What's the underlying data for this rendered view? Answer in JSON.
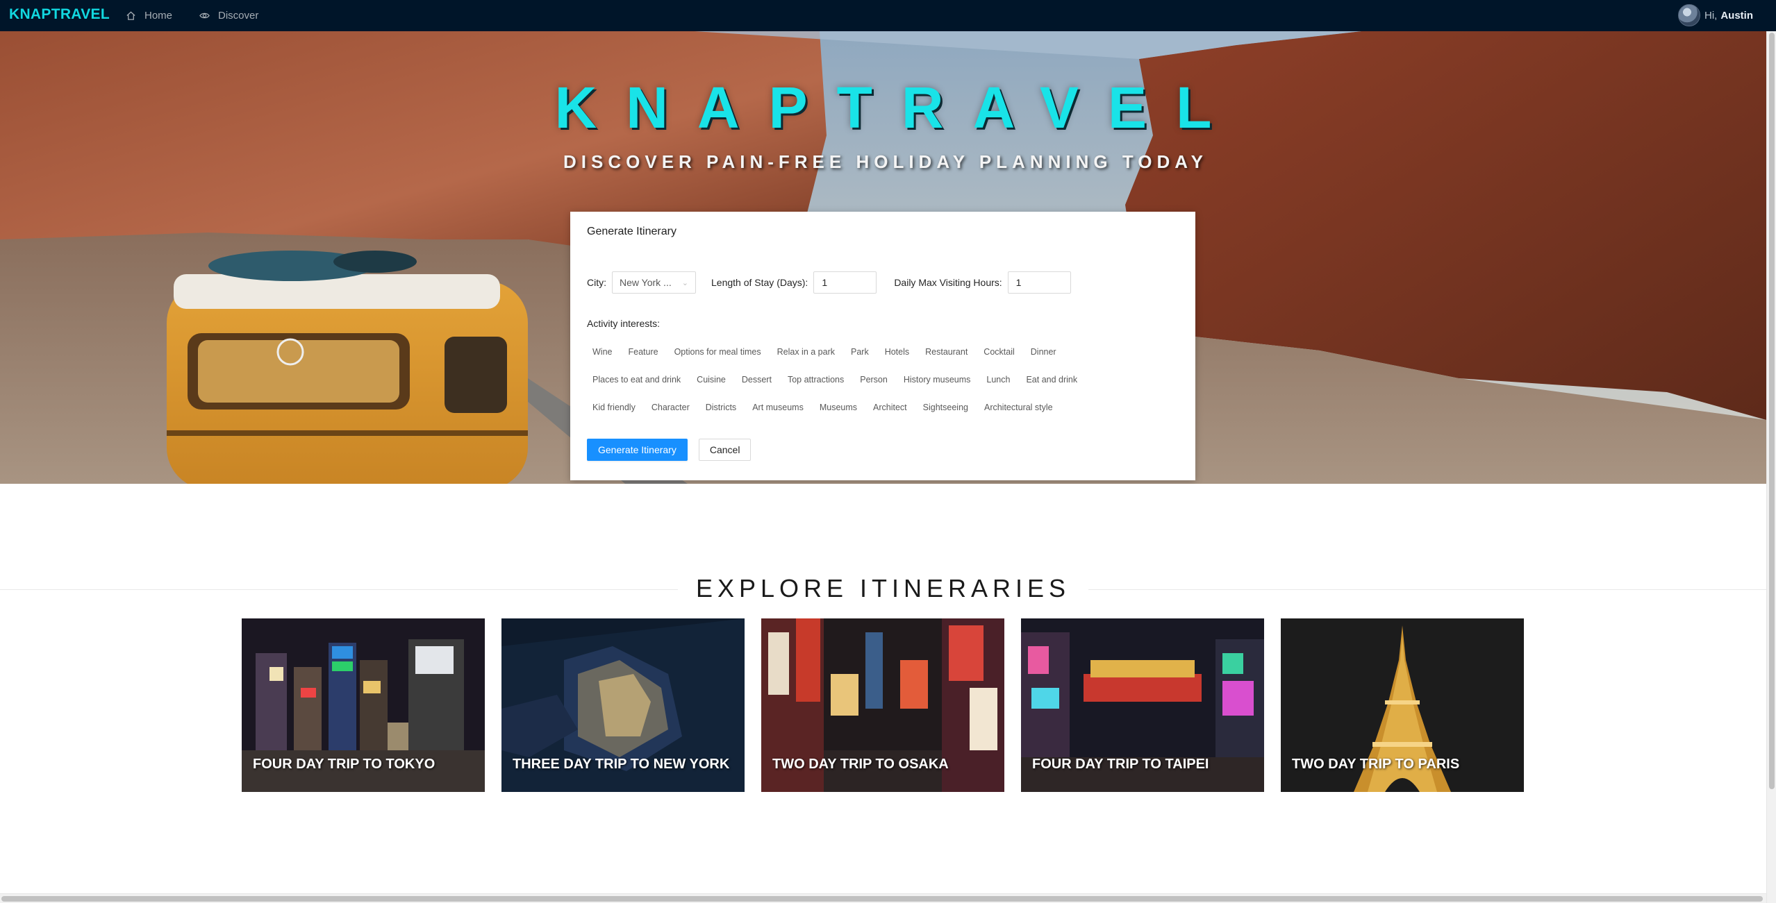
{
  "nav": {
    "brand": "KNAPTRAVEL",
    "items": [
      {
        "label": "Home",
        "icon": "home-icon"
      },
      {
        "label": "Discover",
        "icon": "eye-icon"
      }
    ],
    "user": {
      "greeting": "Hi,",
      "name": "Austin"
    }
  },
  "hero": {
    "title": "KNAPTRAVEL",
    "subtitle": "DISCOVER PAIN-FREE HOLIDAY PLANNING TODAY"
  },
  "form": {
    "title": "Generate Itinerary",
    "city_label": "City",
    "city_value": "New York ...",
    "stay_label": "Length of Stay (Days)",
    "stay_value": "1",
    "hours_label": "Daily Max Visiting Hours",
    "hours_value": "1",
    "interests_label": "Activity interests",
    "interests": [
      [
        "Wine",
        "Feature",
        "Options for meal times",
        "Relax in a park",
        "Park",
        "Hotels",
        "Restaurant",
        "Cocktail",
        "Dinner"
      ],
      [
        "Places to eat and drink",
        "Cuisine",
        "Dessert",
        "Top attractions",
        "Person",
        "History museums",
        "Lunch",
        "Eat and drink"
      ],
      [
        "Kid friendly",
        "Character",
        "Districts",
        "Art museums",
        "Museums",
        "Architect",
        "Sightseeing",
        "Architectural style"
      ]
    ],
    "submit_label": "Generate Itinerary",
    "cancel_label": "Cancel"
  },
  "explore": {
    "title": "EXPLORE ITINERARIES",
    "trips": [
      {
        "label": "FOUR DAY TRIP TO TOKYO"
      },
      {
        "label": "THREE DAY TRIP TO NEW YORK"
      },
      {
        "label": "TWO DAY TRIP TO OSAKA"
      },
      {
        "label": "FOUR DAY TRIP TO TAIPEI"
      },
      {
        "label": "TWO DAY TRIP TO PARIS"
      }
    ]
  },
  "colors": {
    "nav_bg": "#001529",
    "brand": "#12d8e0",
    "hero_title": "#19e3e8",
    "primary_button": "#1890ff"
  }
}
